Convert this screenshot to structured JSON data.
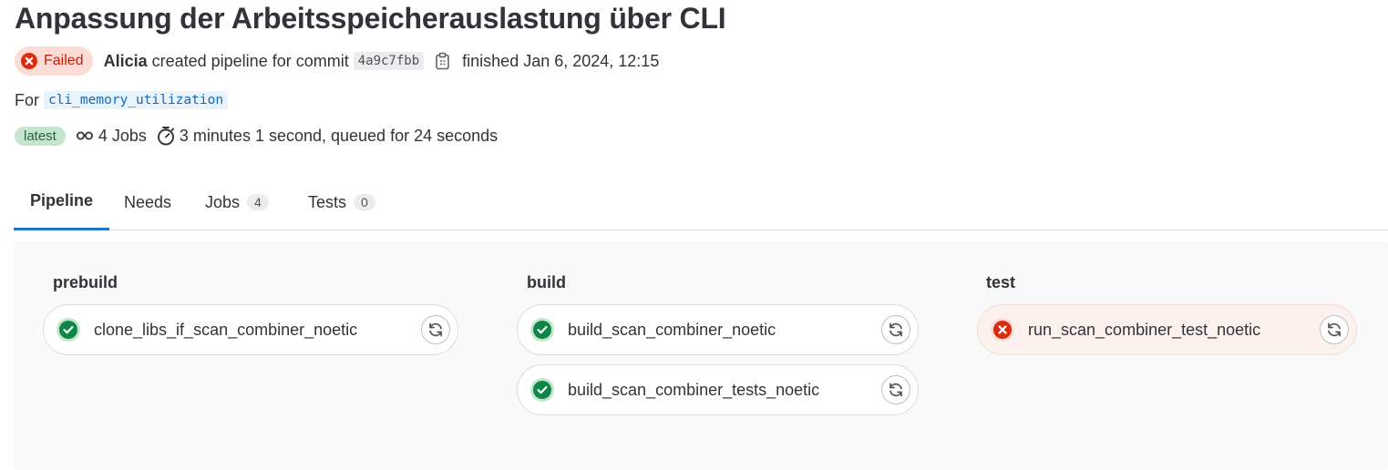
{
  "title": "Anpassung der Arbeitsspeicherauslastung über CLI",
  "status": {
    "label": "Failed",
    "icon": "status-failed-icon",
    "color": "#c91c00"
  },
  "meta": {
    "author": "Alicia",
    "created_text": "created pipeline for commit",
    "commit_sha": "4a9c7fbb",
    "copy_icon": "copy-to-clipboard-icon",
    "finished_text": "finished Jan 6, 2024, 12:15"
  },
  "ref": {
    "prefix": "For",
    "branch": "cli_memory_utilization"
  },
  "info": {
    "latest_badge": "latest",
    "jobs_text": "4 Jobs",
    "duration_text": "3 minutes 1 second, queued for 24 seconds"
  },
  "tabs": [
    {
      "label": "Pipeline",
      "active": true
    },
    {
      "label": "Needs"
    },
    {
      "label": "Jobs",
      "count": "4"
    },
    {
      "label": "Tests",
      "count": "0"
    }
  ],
  "stages": [
    {
      "name": "prebuild",
      "jobs": [
        {
          "name": "clone_libs_if_scan_combiner_noetic",
          "status": "success"
        }
      ]
    },
    {
      "name": "build",
      "jobs": [
        {
          "name": "build_scan_combiner_noetic",
          "status": "success"
        },
        {
          "name": "build_scan_combiner_tests_noetic",
          "status": "success"
        }
      ]
    },
    {
      "name": "test",
      "jobs": [
        {
          "name": "run_scan_combiner_test_noetic",
          "status": "failed"
        }
      ]
    }
  ],
  "colors": {
    "success": "#108548",
    "failed": "#dd2b0e",
    "accent": "#1f75cb"
  }
}
